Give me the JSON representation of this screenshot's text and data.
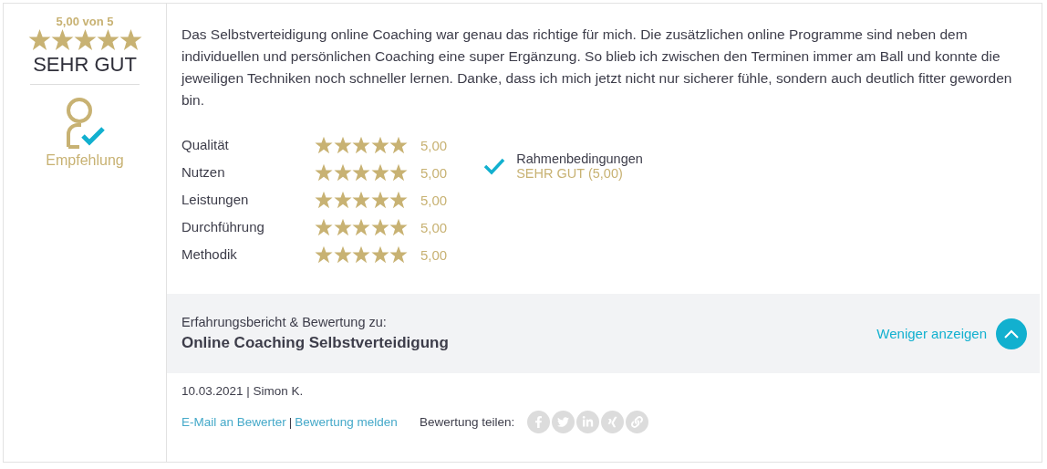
{
  "summary": {
    "score": "5,00 von 5",
    "stars": 5,
    "verdict": "SEHR GUT"
  },
  "recommendation": {
    "label": "Empfehlung",
    "recommended": true
  },
  "review_text": "Das Selbstverteidigung online Coaching war genau das richtige für mich. Die zusätzlichen online Programme sind neben dem individuellen und persönlichen Coaching eine super Ergänzung. So blieb ich zwischen den Terminen immer am Ball und konnte die jeweiligen Techniken noch schneller lernen. Danke, dass ich mich jetzt nicht nur sicherer fühle, sondern auch deutlich fitter geworden bin.",
  "criteria": [
    {
      "label": "Qualität",
      "stars": 5,
      "value": "5,00"
    },
    {
      "label": "Nutzen",
      "stars": 5,
      "value": "5,00"
    },
    {
      "label": "Leistungen",
      "stars": 5,
      "value": "5,00"
    },
    {
      "label": "Durchführung",
      "stars": 5,
      "value": "5,00"
    },
    {
      "label": "Methodik",
      "stars": 5,
      "value": "5,00"
    }
  ],
  "extra_criteria": [
    {
      "label": "Rahmenbedingungen",
      "rating": "SEHR GUT (5,00)",
      "checked": true
    }
  ],
  "product": {
    "caption": "Erfahrungsbericht & Bewertung zu:",
    "title": "Online Coaching Selbstverteidigung"
  },
  "toggle": {
    "label": "Weniger anzeigen",
    "expanded": true
  },
  "meta": "10.03.2021 | Simon K.",
  "links": [
    "E-Mail an Bewerter",
    "Bewertung melden"
  ],
  "links_separator": "|",
  "share_label": "Bewertung teilen:"
}
